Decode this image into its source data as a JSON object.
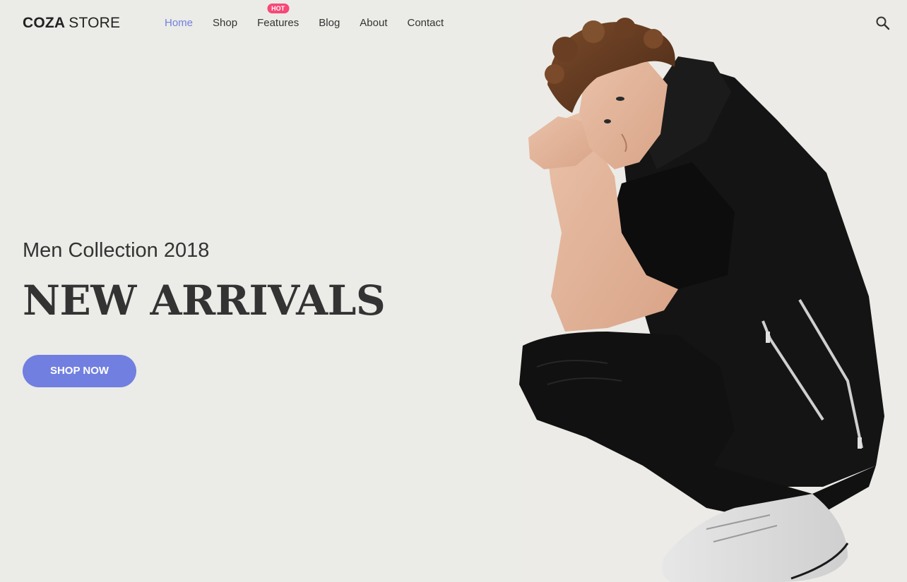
{
  "header": {
    "logo_bold": "COZA",
    "logo_light": "STORE",
    "nav": [
      {
        "label": "Home",
        "active": true
      },
      {
        "label": "Shop"
      },
      {
        "label": "Features",
        "badge": "HOT"
      },
      {
        "label": "Blog"
      },
      {
        "label": "About"
      },
      {
        "label": "Contact"
      }
    ],
    "search_icon": "search-icon"
  },
  "hero": {
    "subtitle": "Men Collection 2018",
    "title": "NEW ARRIVALS",
    "button_label": "SHOP NOW"
  },
  "colors": {
    "accent": "#717fe0",
    "badge": "#f74877",
    "background": "#ebebe7",
    "text": "#333333"
  }
}
